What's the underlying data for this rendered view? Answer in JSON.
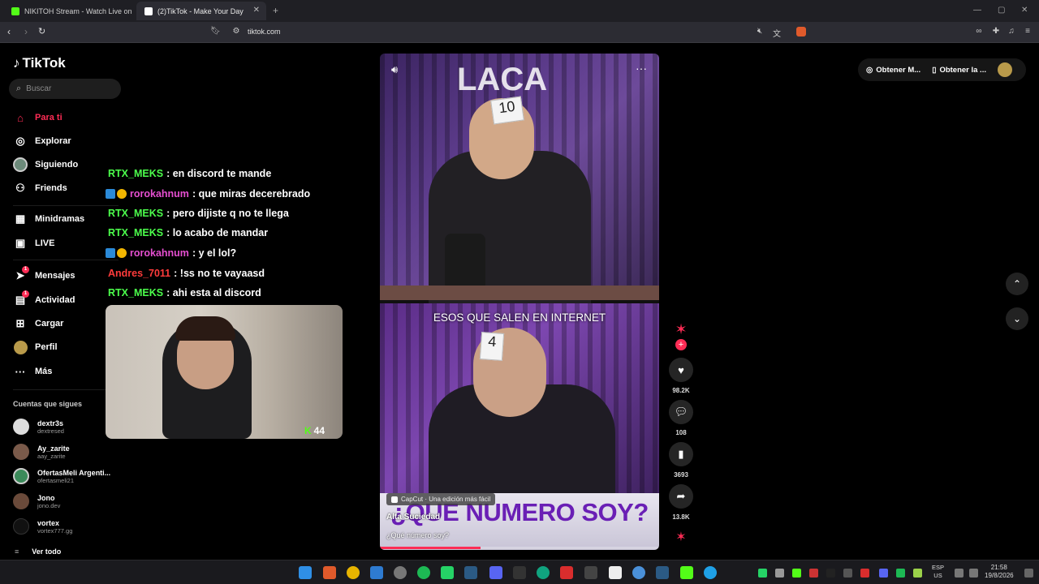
{
  "browser": {
    "tabs": [
      {
        "title": "NIKITOH Stream - Watch Live on"
      },
      {
        "title": "(2)TikTok - Make Your Day"
      }
    ],
    "new_tab": "+",
    "url": "tiktok.com"
  },
  "sidebar": {
    "logo": "TikTok",
    "search_placeholder": "Buscar",
    "nav": [
      {
        "label": "Para ti",
        "icon": "home-icon"
      },
      {
        "label": "Explorar",
        "icon": "compass-icon"
      },
      {
        "label": "Siguiendo",
        "icon": "avatar"
      },
      {
        "label": "Friends",
        "icon": "friends-icon"
      },
      {
        "label": "Minidramas",
        "icon": "minidramas-icon"
      },
      {
        "label": "LIVE",
        "icon": "live-icon"
      },
      {
        "label": "Mensajes",
        "icon": "messages-icon",
        "badge": "1"
      },
      {
        "label": "Actividad",
        "icon": "activity-icon",
        "badge": "1"
      },
      {
        "label": "Cargar",
        "icon": "upload-icon"
      },
      {
        "label": "Perfil",
        "icon": "avatar"
      },
      {
        "label": "Más",
        "icon": "more-icon"
      }
    ],
    "following_title": "Cuentas que sigues",
    "following": [
      {
        "name": "dextr3s",
        "handle": "dextresed"
      },
      {
        "name": "Ay_zarite",
        "handle": "aay_zarite"
      },
      {
        "name": "OfertasMeli Argenti...",
        "handle": "ofertasmeli21"
      },
      {
        "name": "Jono",
        "handle": "jono.dev"
      },
      {
        "name": "vortex",
        "handle": "vortex777.gg"
      }
    ],
    "see_all": "Ver todo"
  },
  "chat": [
    {
      "user": "RTX_MEKS",
      "text": ": en discord te mande",
      "color": "#4cff4c",
      "badges": false
    },
    {
      "user": "rorokahnum",
      "text": ": que miras decerebrado",
      "color": "#e64fd1",
      "badges": true
    },
    {
      "user": "RTX_MEKS",
      "text": ": pero dijiste q no te llega",
      "color": "#4cff4c",
      "badges": false
    },
    {
      "user": "RTX_MEKS",
      "text": ": lo acabo de mandar",
      "color": "#4cff4c",
      "badges": false
    },
    {
      "user": "rorokahnum",
      "text": ": y el lol?",
      "color": "#e64fd1",
      "badges": true
    },
    {
      "user": "Andres_7011",
      "text": ": !ss no te vayaasd",
      "color": "#ff3b3b",
      "badges": false
    },
    {
      "user": "RTX_MEKS",
      "text": ": ahi esta al discord",
      "color": "#4cff4c",
      "badges": false
    }
  ],
  "webcam": {
    "viewer_count": "44"
  },
  "video": {
    "subtitle": "ESOS QUE SALEN EN INTERNET",
    "sign_top": "10",
    "sign_bottom": "4",
    "big_text": "¿QUE NUMERO SOY?",
    "capcut": "CapCut · Una edición más fácil",
    "author": "Alta Suciedad",
    "description": "¿Qué número soy?",
    "progress": 0.36
  },
  "actions": {
    "likes": "98.2K",
    "comments": "108",
    "saves": "3693",
    "shares": "13.8K"
  },
  "topright": {
    "btn1": "Obtener M...",
    "btn2": "Obtener la ..."
  },
  "taskbar": {
    "lang1": "ESP",
    "lang2": "US",
    "time": "21:58",
    "date": "19/8/2026"
  },
  "colors": {
    "accent": "#fe2c55"
  }
}
